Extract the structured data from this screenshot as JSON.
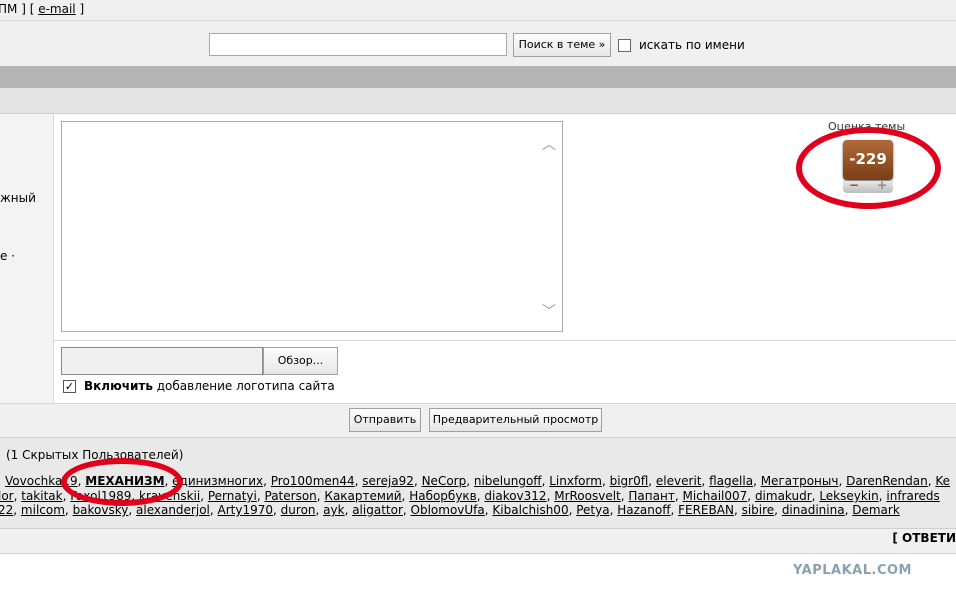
{
  "top_links": {
    "left_bracket": "ПМ ] [",
    "email": "e-mail",
    "right_bracket": "]"
  },
  "search": {
    "value": "",
    "button_label": "Поиск в теме »",
    "by_name_label": "искать по имени"
  },
  "left_panel": {
    "line1": "жный",
    "line2": "е ·"
  },
  "rating": {
    "label": "Оценка темы",
    "value": "-229",
    "minus": "−",
    "plus": "+"
  },
  "file": {
    "browse_label": "Обзор...",
    "logo_bold": "Включить",
    "logo_rest": " добавление логотипа сайта",
    "logo_checked": "✓"
  },
  "actions": {
    "send": "Отправить",
    "preview": "Предварительный просмотр"
  },
  "readers": {
    "header": "(1 Скрытых Пользователей)",
    "line1": [
      "Vovochka19",
      "МЕХАНИЗМ",
      "единизмногих",
      "Pro100men44",
      "sereja92",
      "NeCorp",
      "nibelungoff",
      "Linxform",
      "bigr0fl",
      "eleverit",
      "flagella",
      "Мегатроныч",
      "DarenRendan",
      "Ke"
    ],
    "line2": [
      "lor",
      "takitak",
      "Faxol1989",
      "kravenskii",
      "Pernatyi",
      "Paterson",
      "Какартемий",
      "Наборбукв",
      "diakov312",
      "MrRoosvelt",
      "Папант",
      "Michail007",
      "dimakudr",
      "Lekseykin",
      "infrareds"
    ],
    "line3": [
      "22",
      "milcom",
      "bakovsky",
      "alexanderjol",
      "Arty1970",
      "duron",
      "ayk",
      "aligattor",
      "OblomovUfa",
      "Kibalchish00",
      "Petya",
      "Hazanoff",
      "FEREBAN",
      "sibire",
      "dinadinina",
      "Demark"
    ]
  },
  "reply_bar": {
    "label": "[ ОТВЕТИ"
  },
  "watermark": "YAPLAKAL.COM",
  "colors": {
    "annotation": "#e0001b",
    "rating_bg": "#9a5226"
  }
}
